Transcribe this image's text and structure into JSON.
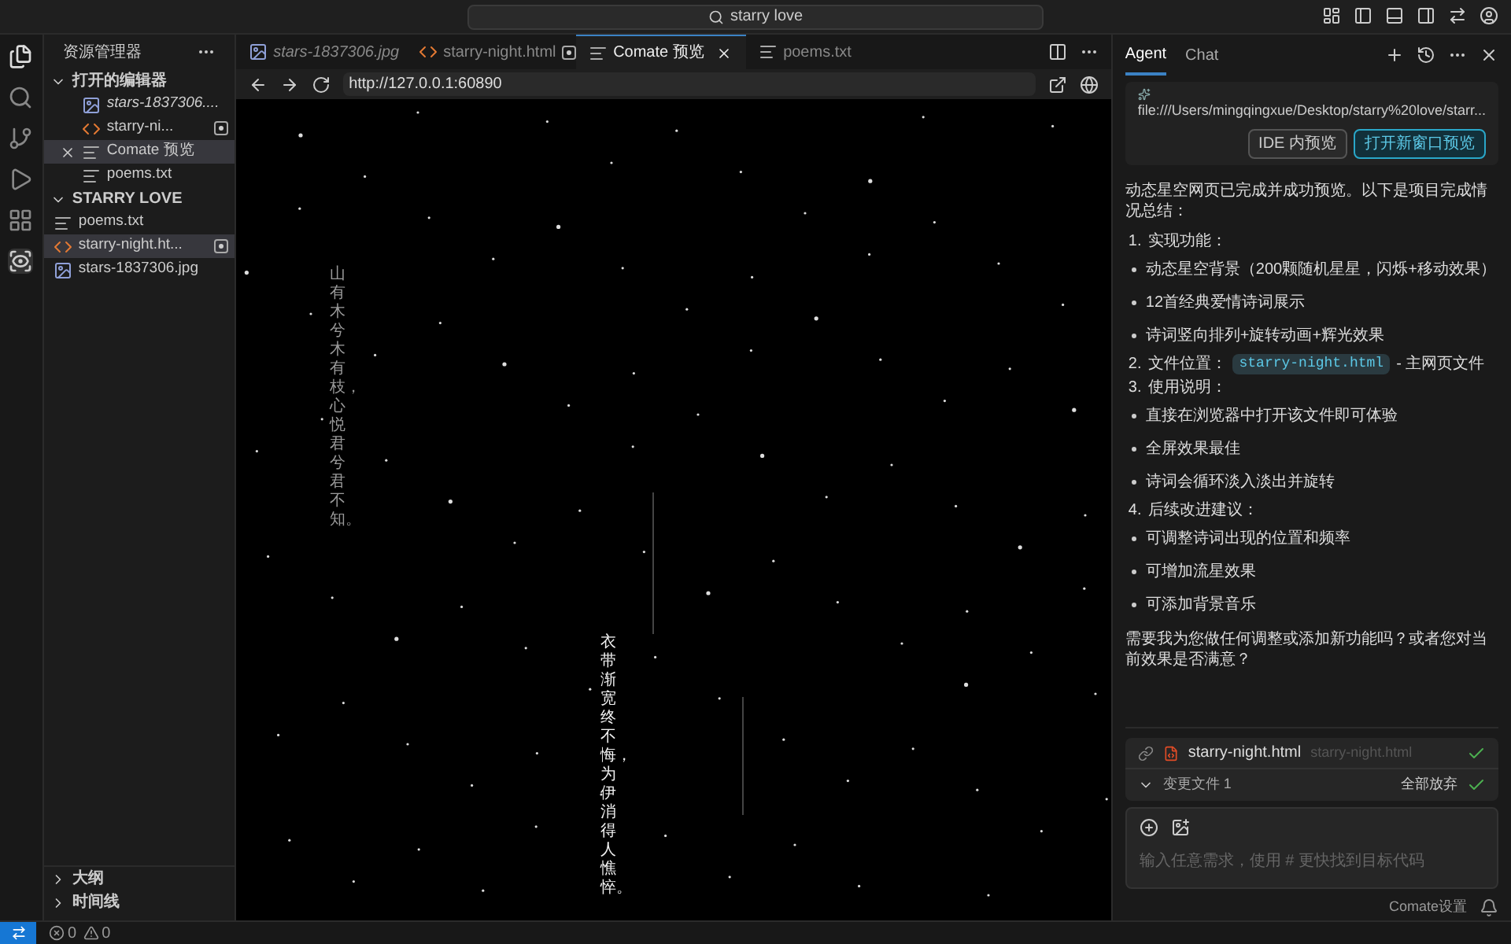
{
  "search": {
    "value": "starry love"
  },
  "sidebar": {
    "title": "资源管理器",
    "sections": [
      {
        "title": "打开的编辑器",
        "expanded": true,
        "items": [
          {
            "label": "stars-1837306....",
            "kind": "image",
            "preview": true,
            "modified": false,
            "selected": false,
            "closable": false
          },
          {
            "label": "starry-ni...",
            "kind": "html",
            "preview": false,
            "modified": true,
            "selected": false,
            "closable": false
          },
          {
            "label": "Comate 预览",
            "kind": "text",
            "preview": false,
            "modified": false,
            "selected": true,
            "closable": true
          },
          {
            "label": "poems.txt",
            "kind": "text",
            "preview": false,
            "modified": false,
            "selected": false,
            "closable": false
          }
        ]
      },
      {
        "title": "STARRY LOVE",
        "expanded": true,
        "items": [
          {
            "label": "poems.txt",
            "kind": "text",
            "preview": false,
            "modified": false,
            "selected": false,
            "closable": false
          },
          {
            "label": "starry-night.ht...",
            "kind": "html",
            "preview": false,
            "modified": true,
            "selected": true,
            "closable": false
          },
          {
            "label": "stars-1837306.jpg",
            "kind": "image",
            "preview": false,
            "modified": false,
            "selected": false,
            "closable": false
          }
        ]
      }
    ],
    "bottom_sections": [
      {
        "title": "大纲",
        "expanded": false
      },
      {
        "title": "时间线",
        "expanded": false
      }
    ]
  },
  "tabs": [
    {
      "label": "stars-1837306.jpg",
      "kind": "image",
      "preview": true,
      "modified": false,
      "selected": false
    },
    {
      "label": "starry-night.html",
      "kind": "html",
      "preview": false,
      "modified": true,
      "selected": false
    },
    {
      "label": "Comate 预览",
      "kind": "text",
      "preview": false,
      "modified": false,
      "selected": true
    },
    {
      "label": "poems.txt",
      "kind": "text",
      "preview": false,
      "modified": false,
      "selected": false
    }
  ],
  "browser": {
    "url": "http://127.0.0.1:60890"
  },
  "poems": [
    {
      "text": "山有木兮木有枝，心悦君兮君不知。"
    },
    {
      "text": "衣带渐宽终不悔，为伊消得人憔悴。"
    }
  ],
  "agent": {
    "tabs": [
      {
        "label": "Agent",
        "selected": true
      },
      {
        "label": "Chat",
        "selected": false
      }
    ],
    "preview_card": {
      "path": "file:///Users/mingqingxue/Desktop/starry%20love/starr...",
      "buttons": [
        {
          "label": "IDE 内预览",
          "kind": "secondary"
        },
        {
          "label": "打开新窗口预览",
          "kind": "primary"
        }
      ]
    },
    "message": [
      {
        "kind": "para",
        "text": "动态星空网页已完成并成功预览。以下是项目完成情况总结："
      },
      {
        "kind": "numbered",
        "number": "1.",
        "text": "实现功能："
      },
      {
        "kind": "bullet",
        "text": "动态星空背景（200颗随机星星，闪烁+移动效果）"
      },
      {
        "kind": "bullet",
        "text": "12首经典爱情诗词展示"
      },
      {
        "kind": "bullet",
        "text": "诗词竖向排列+旋转动画+辉光效果"
      },
      {
        "kind": "numbered",
        "number": "2.",
        "text": "文件位置：",
        "code": "starry-night.html",
        "after": "- 主网页文件"
      },
      {
        "kind": "numbered",
        "number": "3.",
        "text": "使用说明："
      },
      {
        "kind": "bullet",
        "text": "直接在浏览器中打开该文件即可体验"
      },
      {
        "kind": "bullet",
        "text": "全屏效果最佳"
      },
      {
        "kind": "bullet",
        "text": "诗词会循环淡入淡出并旋转"
      },
      {
        "kind": "numbered",
        "number": "4.",
        "text": "后续改进建议："
      },
      {
        "kind": "bullet",
        "text": "可调整诗词出现的位置和频率"
      },
      {
        "kind": "bullet",
        "text": "可增加流星效果"
      },
      {
        "kind": "bullet",
        "text": "可添加背景音乐"
      },
      {
        "kind": "para",
        "text": "需要我为您做任何调整或添加新功能吗？或者您对当前效果是否满意？"
      }
    ],
    "change_card": {
      "file": "starry-night.html",
      "path": "starry-night.html",
      "accepted": true,
      "summary": "变更文件 1",
      "action": "全部放弃"
    },
    "input": {
      "placeholder": "输入任意需求，使用 # 更快找到目标代码"
    },
    "footer": "Comate设置"
  },
  "status_bar": {
    "errors": "0",
    "warnings": "0"
  }
}
